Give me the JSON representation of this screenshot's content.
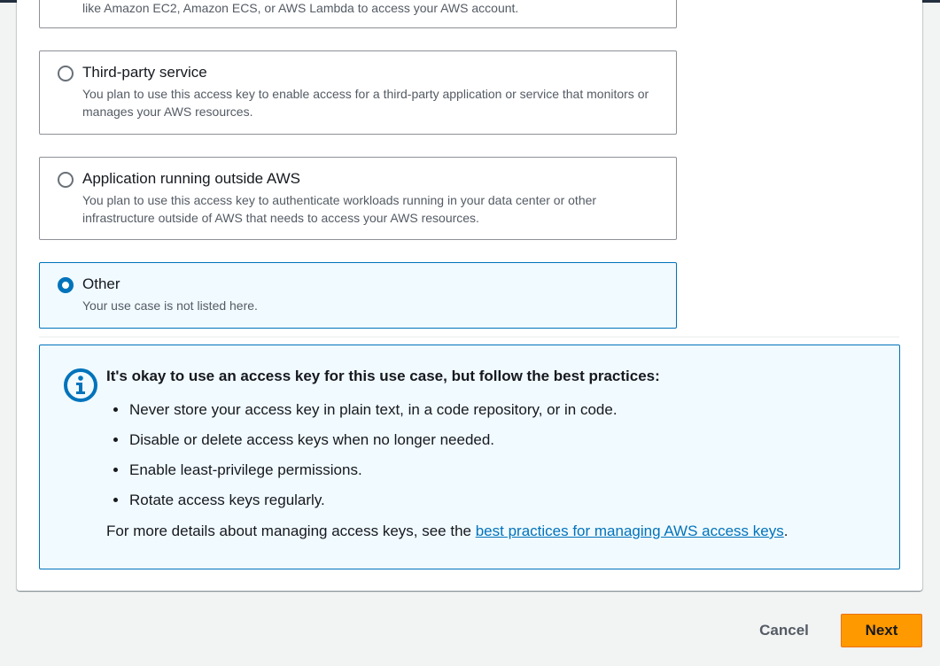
{
  "options": [
    {
      "label": "",
      "description": "like Amazon EC2, Amazon ECS, or AWS Lambda to access your AWS account.",
      "selected": false
    },
    {
      "label": "Third-party service",
      "description": "You plan to use this access key to enable access for a third-party application or service that monitors or manages your AWS resources.",
      "selected": false
    },
    {
      "label": "Application running outside AWS",
      "description": "You plan to use this access key to authenticate workloads running in your data center or other infrastructure outside of AWS that needs to access your AWS resources.",
      "selected": false
    },
    {
      "label": "Other",
      "description": "Your use case is not listed here.",
      "selected": true
    }
  ],
  "alert": {
    "icon": "info-icon",
    "heading": "It's okay to use an access key for this use case, but follow the best practices:",
    "items": [
      "Never store your access key in plain text, in a code repository, or in code.",
      "Disable or delete access keys when no longer needed.",
      "Enable least-privilege permissions.",
      "Rotate access keys regularly."
    ],
    "footer_prefix": "For more details about managing access keys, see the ",
    "footer_link": "best practices for managing AWS access keys",
    "footer_suffix": "."
  },
  "actions": {
    "cancel_label": "Cancel",
    "next_label": "Next"
  },
  "colors": {
    "accent": "#0073bb",
    "primary_button": "#ff9900"
  }
}
